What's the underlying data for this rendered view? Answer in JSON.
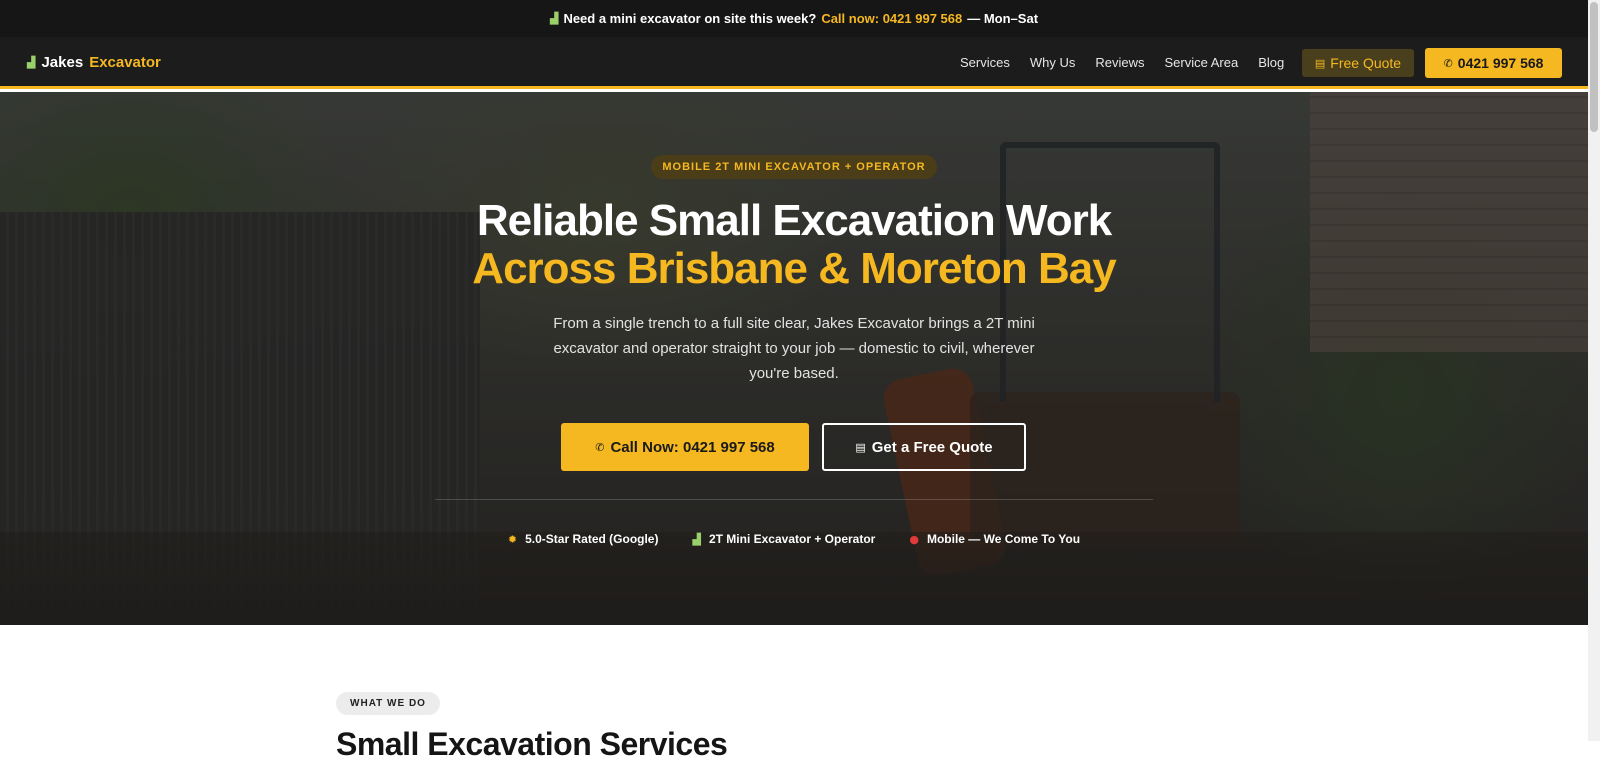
{
  "topbar": {
    "icon": "excavator-icon",
    "text": "Need a mini excavator on site this week?",
    "call_text": "Call now: 0421 997 568",
    "suffix": "— Mon–Sat"
  },
  "nav": {
    "brand_first": "Jakes",
    "brand_second": "Excavator",
    "brand_icon": "excavator-icon",
    "items": [
      {
        "label": "Services"
      },
      {
        "label": "Why Us"
      },
      {
        "label": "Reviews"
      },
      {
        "label": "Service Area"
      },
      {
        "label": "Blog"
      }
    ],
    "quote_button": "Free Quote",
    "quote_icon": "clipboard-icon",
    "phone_button": "0421 997 568",
    "phone_icon": "phone-icon"
  },
  "hero": {
    "badge": "MOBILE 2T MINI EXCAVATOR + OPERATOR",
    "headline_line1": "Reliable Small Excavation Work",
    "headline_line2": "Across Brisbane & Moreton Bay",
    "lead": "From a single trench to a full site clear, Jakes Excavator brings a 2T mini excavator and operator straight to your job — domestic to civil, wherever you're based.",
    "cta_call": "Call Now: 0421 997 568",
    "cta_quote": "Get a Free Quote",
    "trust": [
      {
        "icon": "star-icon",
        "label": "5.0-Star Rated (Google)"
      },
      {
        "icon": "excavator-icon",
        "label": "2T Mini Excavator + Operator"
      },
      {
        "icon": "pin-icon",
        "label": "Mobile — We Come To You"
      }
    ]
  },
  "services": {
    "tag": "WHAT WE DO",
    "title": "Small Excavation Services"
  },
  "colors": {
    "accent": "#f5b820",
    "dark": "#1c1c1c",
    "topbar": "#161616"
  }
}
